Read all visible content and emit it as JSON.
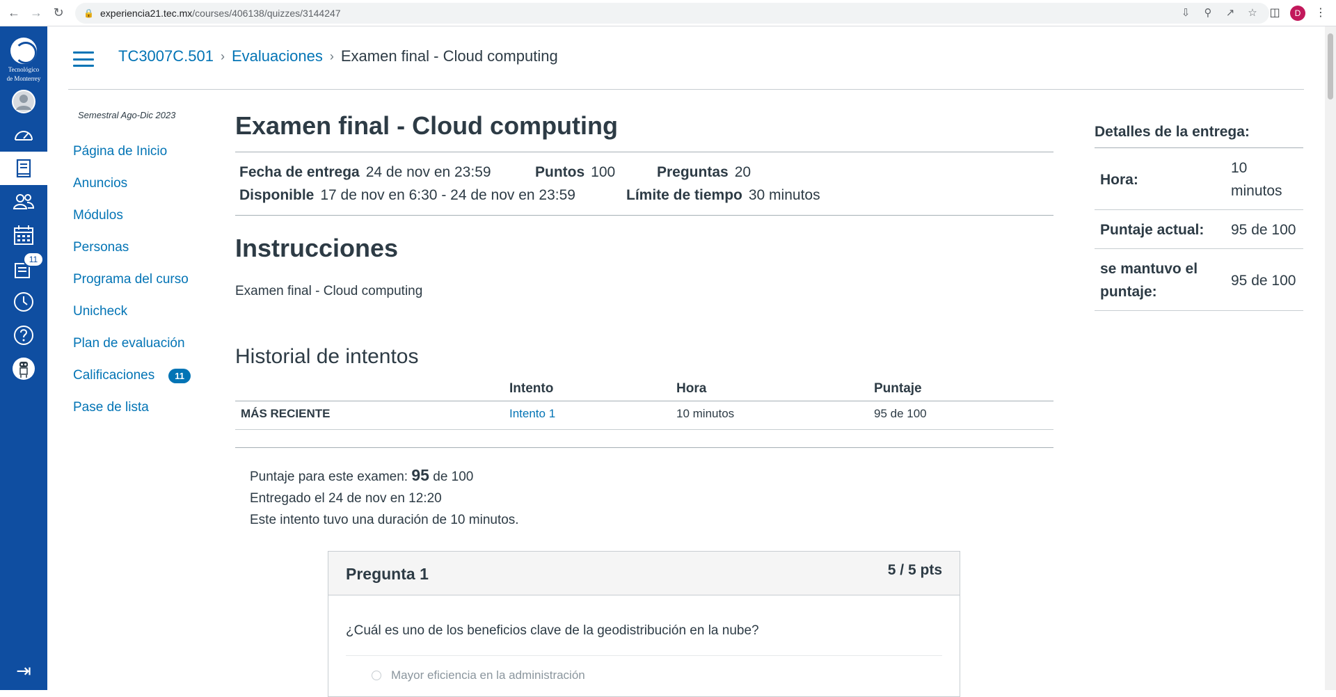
{
  "browser": {
    "url_domain": "experiencia21.tec.mx",
    "url_path": "/courses/406138/quizzes/3144247",
    "profile_initial": "D"
  },
  "global_nav": {
    "logo_text_line1": "Tecnológico",
    "logo_text_line2": "de Monterrey",
    "inbox_badge": "11",
    "accent_color": "#0f4ea1"
  },
  "breadcrumb": {
    "course": "TC3007C.501",
    "section": "Evaluaciones",
    "current": "Examen final - Cloud computing",
    "separator": "›"
  },
  "course_nav": {
    "term": "Semestral Ago-Dic 2023",
    "items": [
      {
        "label": "Página de Inicio"
      },
      {
        "label": "Anuncios"
      },
      {
        "label": "Módulos"
      },
      {
        "label": "Personas"
      },
      {
        "label": "Programa del curso"
      },
      {
        "label": "Unicheck"
      },
      {
        "label": "Plan de evaluación"
      },
      {
        "label": "Calificaciones",
        "badge": "11"
      },
      {
        "label": "Pase de lista"
      }
    ]
  },
  "quiz": {
    "title": "Examen final - Cloud computing",
    "due_label": "Fecha de entrega",
    "due_value": "24 de nov en 23:59",
    "points_label": "Puntos",
    "points_value": "100",
    "questions_label": "Preguntas",
    "questions_value": "20",
    "available_label": "Disponible",
    "available_value": "17 de nov en 6:30 - 24 de nov en 23:59",
    "time_limit_label": "Límite de tiempo",
    "time_limit_value": "30 minutos",
    "instructions_heading": "Instrucciones",
    "instructions_text": "Examen final - Cloud computing"
  },
  "history": {
    "heading": "Historial de intentos",
    "columns": [
      "",
      "Intento",
      "Hora",
      "Puntaje"
    ],
    "rows": [
      {
        "label": "MÁS RECIENTE",
        "attempt": "Intento 1",
        "time": "10 minutos",
        "score": "95 de 100"
      }
    ]
  },
  "summary": {
    "score_prefix": "Puntaje para este examen:",
    "score_value": "95",
    "score_suffix": "de 100",
    "submitted": "Entregado el 24 de nov en 12:20",
    "duration": "Este intento tuvo una duración de 10 minutos."
  },
  "question": {
    "title": "Pregunta 1",
    "points": "5 / 5 pts",
    "text": "¿Cuál es uno de los beneficios clave de la geodistribución en la nube?",
    "option_1": "Mayor eficiencia en la administración"
  },
  "details": {
    "heading": "Detalles de la entrega:",
    "rows": [
      {
        "key": "Hora:",
        "value": "10 minutos"
      },
      {
        "key": "Puntaje actual:",
        "value": "95 de 100"
      },
      {
        "key": "se mantuvo el puntaje:",
        "value": "95 de 100"
      }
    ]
  }
}
